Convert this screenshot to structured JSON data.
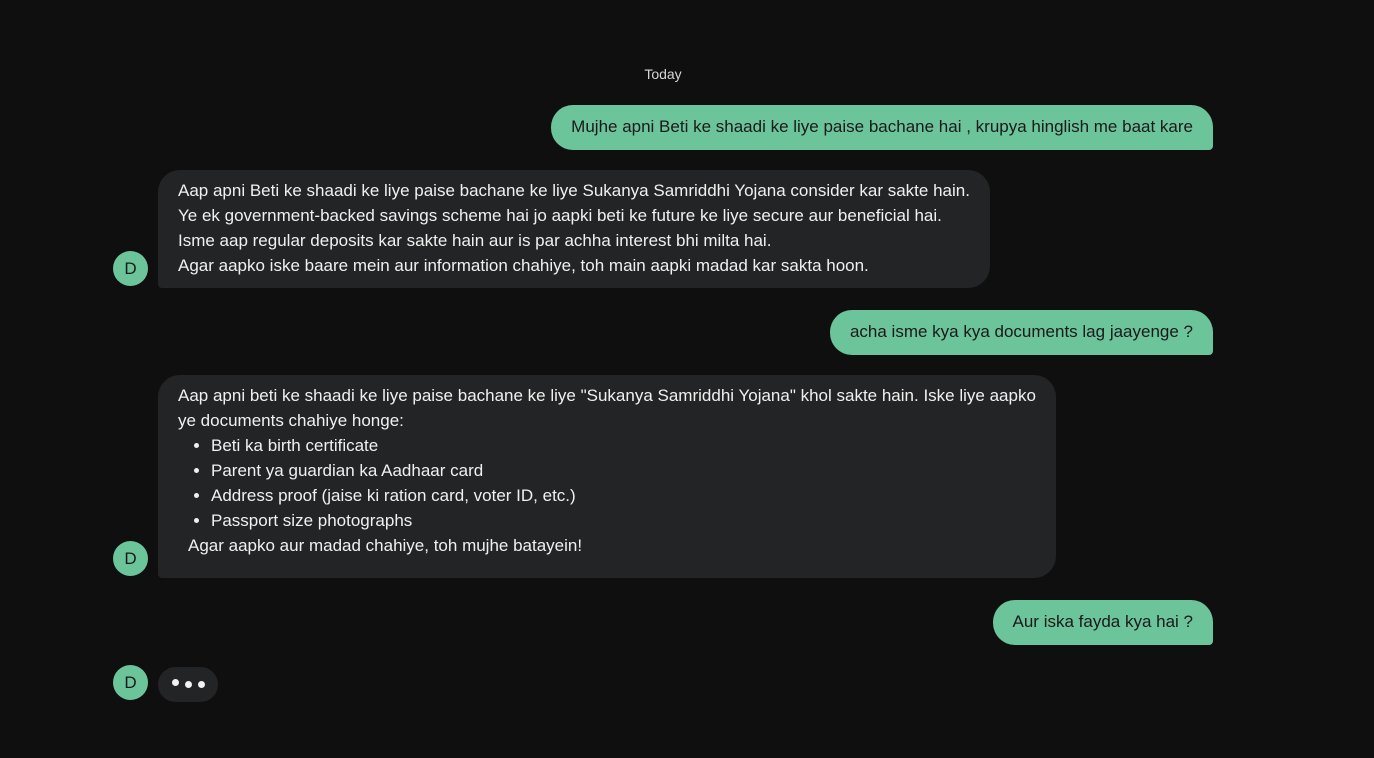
{
  "colors": {
    "background": "#0f0f0f",
    "user_bubble": "#6cc49b",
    "bot_bubble": "#232425",
    "avatar": "#6cc49b"
  },
  "date_separator": "Today",
  "avatar_letter": "D",
  "messages": {
    "user_1": "Mujhe apni Beti ke shaadi ke liye paise bachane hai , krupya hinglish me baat kare",
    "bot_1": {
      "lines": [
        "Aap apni Beti ke shaadi ke liye paise bachane ke liye Sukanya Samriddhi Yojana consider kar sakte hain.",
        "Ye ek government-backed savings scheme hai jo aapki beti ke future ke liye secure aur beneficial hai.",
        "Isme aap regular deposits kar sakte hain aur is par achha interest bhi milta hai.",
        "Agar aapko iske baare mein aur information chahiye, toh main aapki madad kar sakta hoon."
      ]
    },
    "user_2": "acha isme kya kya documents lag jaayenge ?",
    "bot_2": {
      "intro_1": "Aap apni beti ke shaadi ke liye paise bachane ke liye \"Sukanya Samriddhi Yojana\" khol sakte hain. Iske liye aapko",
      "intro_2": "ye documents chahiye honge:",
      "items": [
        "Beti ka birth certificate",
        "Parent ya guardian ka Aadhaar card",
        "Address proof (jaise ki ration card, voter ID, etc.)",
        "Passport size photographs"
      ],
      "closing": "Agar aapko aur madad chahiye, toh mujhe batayein!"
    },
    "user_3": "Aur iska fayda kya hai ?"
  }
}
